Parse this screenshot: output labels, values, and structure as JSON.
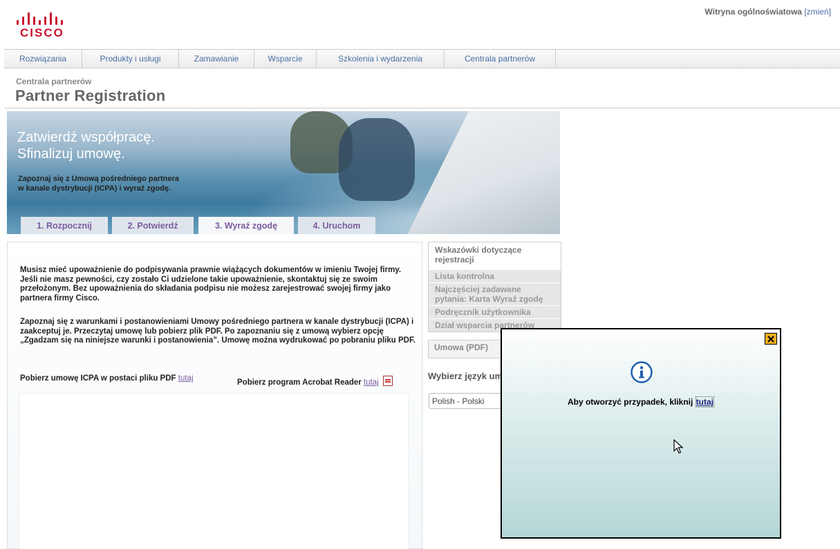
{
  "header": {
    "logo_text": "CISCO",
    "site_label": "Witryna ogólnoświatowa",
    "site_change_link": "[zmień]"
  },
  "nav": {
    "items": [
      "Rozwiązania",
      "Produkty i usługi",
      "Zamawianie",
      "Wsparcie",
      "Szkolenia i wydarzenia",
      "Centrala partnerów"
    ]
  },
  "page": {
    "breadcrumb": "Centrala partnerów",
    "title": "Partner Registration"
  },
  "hero": {
    "headline_1": "Zatwierdź współpracę.",
    "headline_2": "Sfinalizuj umowę.",
    "sub_1": "Zapoznaj się z Umową pośredniego partnera",
    "sub_2": "w kanale dystrybucji (ICPA) i wyraź zgodę."
  },
  "steps": [
    {
      "label": "1. Rozpocznij",
      "active": false
    },
    {
      "label": "2. Potwierdź",
      "active": false
    },
    {
      "label": "3. Wyraź zgodę",
      "active": true
    },
    {
      "label": "4. Uruchom",
      "active": false
    }
  ],
  "content": {
    "para_1": "Musisz mieć upoważnienie do podpisywania prawnie wiążących dokumentów w imieniu Twojej firmy. Jeśli nie masz pewności, czy zostało Ci udzielone takie upoważnienie, skontaktuj się ze swoim przełożonym. Bez upoważnienia do składania podpisu nie możesz zarejestrować swojej firmy jako partnera firmy Cisco.",
    "para_2": "Zapoznaj się z warunkami i postanowieniami Umowy pośredniego partnera w kanale dystrybucji (ICPA) i zaakceptuj je. Przeczytaj umowę lub pobierz plik PDF. Po zapoznaniu się z umową wybierz opcję „Zgadzam się na niniejsze warunki i postanowienia”. Umowę można wydrukować po pobraniu pliku PDF.",
    "download_pdf_text": "Pobierz umowę ICPA w postaci pliku PDF",
    "download_pdf_link": "tutaj",
    "download_reader_text": "Pobierz program Acrobat Reader",
    "download_reader_link": "tutaj"
  },
  "sidebar": {
    "heading": "Wskazówki dotyczące rejestracji",
    "links": [
      "Lista kontrolna",
      "Najczęściej zadawane pytania: Karta Wyraź zgodę",
      "Podręcznik użytkownika",
      "Dział wsparcia partnerów"
    ],
    "pdf_box": "Umowa (PDF)",
    "language_label": "Wybierz język um",
    "language_value": "Polish - Polski"
  },
  "popup": {
    "message": "Aby otworzyć przypadek, kliknij",
    "link": "tutaj",
    "icon": "info-icon"
  },
  "colors": {
    "brand": "#c8102e",
    "nav_link": "#4a6fa5",
    "step_text": "#7b5b9e"
  }
}
